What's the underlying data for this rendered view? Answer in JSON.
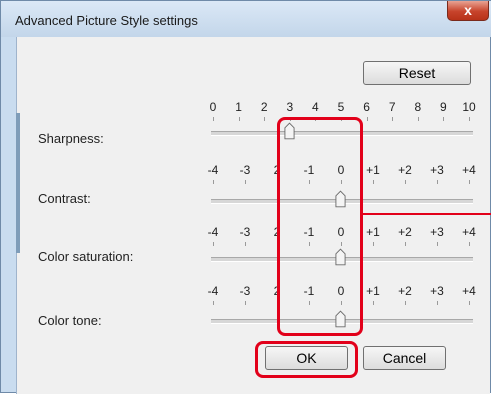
{
  "window": {
    "title": "Advanced Picture Style settings",
    "close_symbol": "x"
  },
  "buttons": {
    "reset": "Reset",
    "ok": "OK",
    "cancel": "Cancel"
  },
  "sliders": [
    {
      "label": "Sharpness:",
      "scale": [
        "0",
        "1",
        "2",
        "3",
        "4",
        "5",
        "6",
        "7",
        "8",
        "9",
        "10"
      ],
      "value": "3"
    },
    {
      "label": "Contrast:",
      "scale": [
        "-4",
        "-3",
        "2",
        "-1",
        "0",
        "+1",
        "+2",
        "+3",
        "+4"
      ],
      "value": "0"
    },
    {
      "label": "Color saturation:",
      "scale": [
        "-4",
        "-3",
        "2",
        "-1",
        "0",
        "+1",
        "+2",
        "+3",
        "+4"
      ],
      "value": "0"
    },
    {
      "label": "Color tone:",
      "scale": [
        "-4",
        "-3",
        "2",
        "-1",
        "0",
        "+1",
        "+2",
        "+3",
        "+4"
      ],
      "value": "0"
    }
  ],
  "colors": {
    "highlight": "#e2001a"
  }
}
